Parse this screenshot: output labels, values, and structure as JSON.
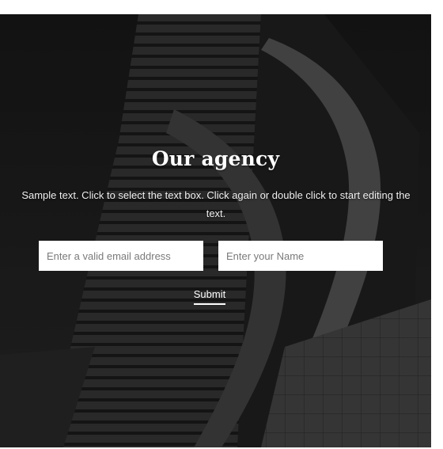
{
  "hero": {
    "title": "Our agency",
    "description": "Sample text. Click to select the text box. Click again or double click to start editing the text."
  },
  "form": {
    "email_placeholder": "Enter a valid email address",
    "name_placeholder": "Enter your Name",
    "submit_label": "Submit"
  },
  "colors": {
    "background_dark": "#0b0b0b",
    "text_light": "#ffffff",
    "input_bg": "#ffffff"
  }
}
